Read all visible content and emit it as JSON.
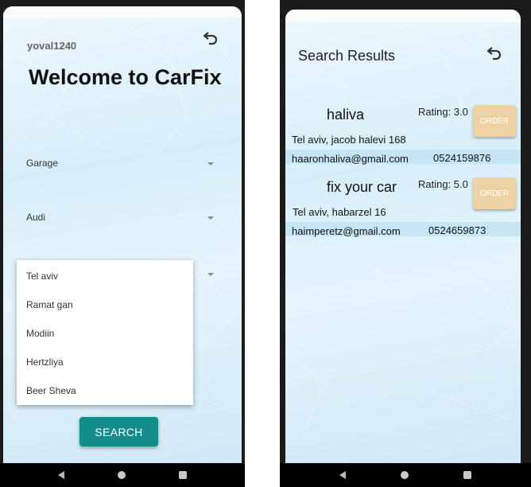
{
  "left_screen": {
    "username": "yoval1240",
    "welcome": "Welcome to CarFix",
    "spinners": {
      "category": "Garage",
      "brand": "Audi"
    },
    "city_options": [
      "Tel aviv",
      "Ramat gan",
      "Modiin",
      "Hertzliya",
      "Beer Sheva"
    ],
    "search_label": "SEARCH"
  },
  "right_screen": {
    "title": "Search Results",
    "results": [
      {
        "name": "haliva",
        "rating": "Rating: 3.0",
        "address": "Tel aviv, jacob halevi 168",
        "email": "haaronhaliva@gmail.com",
        "phone": "0524159876",
        "order_label": "ORDER"
      },
      {
        "name": "fix your car",
        "rating": "Rating: 5.0",
        "address": "Tel aviv, habarzel 16",
        "email": "haimperetz@gmail.com",
        "phone": "0524659873",
        "order_label": "ORDER"
      }
    ]
  },
  "icons": {
    "back": "undo-back-icon",
    "nav_back": "nav-back-icon",
    "nav_home": "nav-home-icon",
    "nav_recent": "nav-recent-icon"
  },
  "colors": {
    "search_button": "#138c8c",
    "order_button": "#edd3a3",
    "background": "#d7eef9"
  }
}
